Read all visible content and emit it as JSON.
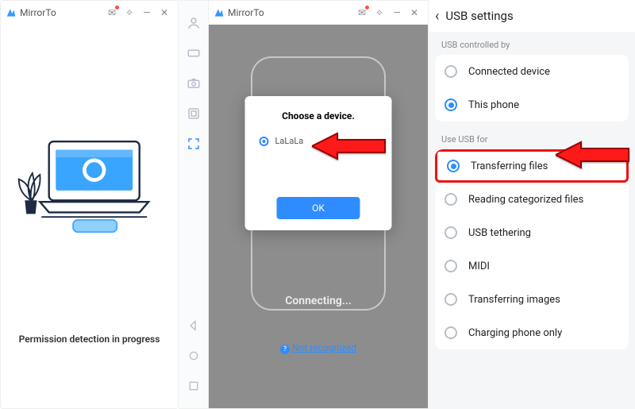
{
  "p1": {
    "app": "MirrorTo",
    "caption": "Permission detection in progress"
  },
  "p2": {
    "app": "MirrorTo",
    "connecting": "Connecting...",
    "not_recognized": "Not recognized",
    "modal": {
      "title": "Choose a device.",
      "device": "LaLaLa",
      "ok": "OK"
    }
  },
  "p3": {
    "title": "USB settings",
    "section1": "USB controlled by",
    "opts1": [
      "Connected device",
      "This phone"
    ],
    "opts1_selected_index": 1,
    "section2": "Use USB for",
    "opts2": [
      "Transferring files",
      "Reading categorized files",
      "USB tethering",
      "MIDI",
      "Transferring images",
      "Charging phone only"
    ],
    "opts2_selected_index": 0
  },
  "colors": {
    "accent": "#2f8cff",
    "arrow": "#ff1a1a"
  }
}
